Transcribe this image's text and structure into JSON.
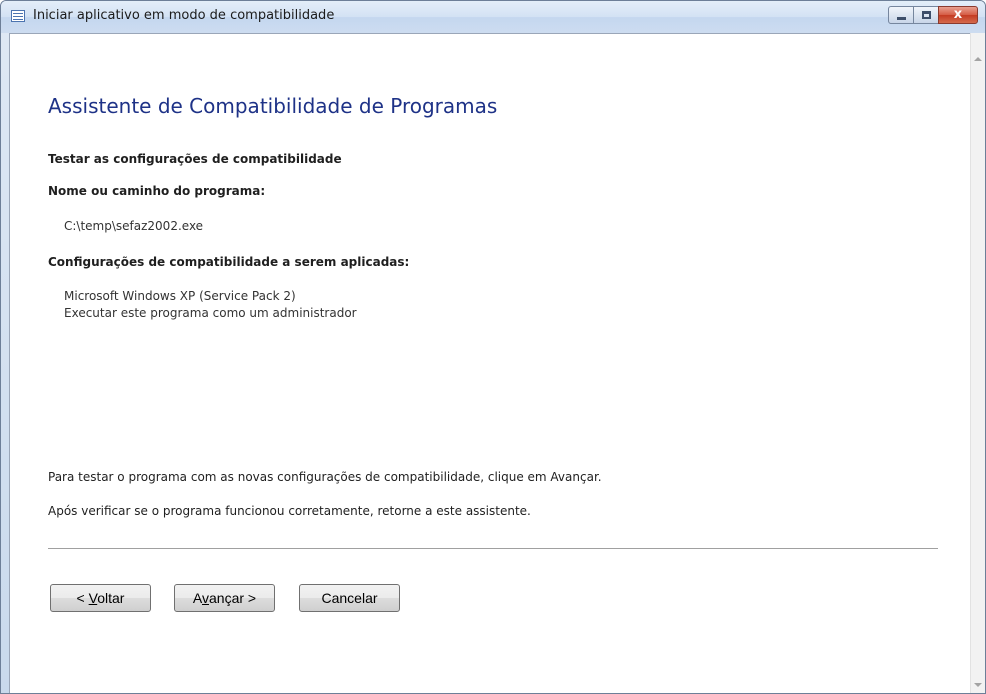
{
  "window": {
    "title": "Iniciar aplicativo em modo de compatibilidade"
  },
  "titlebar_buttons": {
    "minimize_icon": "minimize-icon",
    "maximize_icon": "maximize-icon",
    "close_symbol": "x"
  },
  "content": {
    "heading": "Assistente de Compatibilidade de Programas",
    "section_title": "Testar as configurações de compatibilidade",
    "program_label": "Nome ou caminho do programa:",
    "program_path": "C:\\temp\\sefaz2002.exe",
    "settings_label": "Configurações de compatibilidade a serem aplicadas:",
    "settings": [
      "Microsoft Windows XP (Service Pack 2)",
      "Executar este programa como um administrador"
    ],
    "instruction_1": "Para testar o programa com as novas configurações de compatibilidade, clique em Avançar.",
    "instruction_2": "Após verificar se o programa funcionou corretamente, retorne a este assistente."
  },
  "buttons": {
    "back": {
      "pre": "< ",
      "accel": "V",
      "post": "oltar"
    },
    "next": {
      "pre": "A",
      "accel": "v",
      "post": "ançar >"
    },
    "cancel": "Cancelar"
  },
  "colors": {
    "heading": "#1e3287",
    "close_button": "#c43b22",
    "title_bar": "#d3e2f4"
  }
}
